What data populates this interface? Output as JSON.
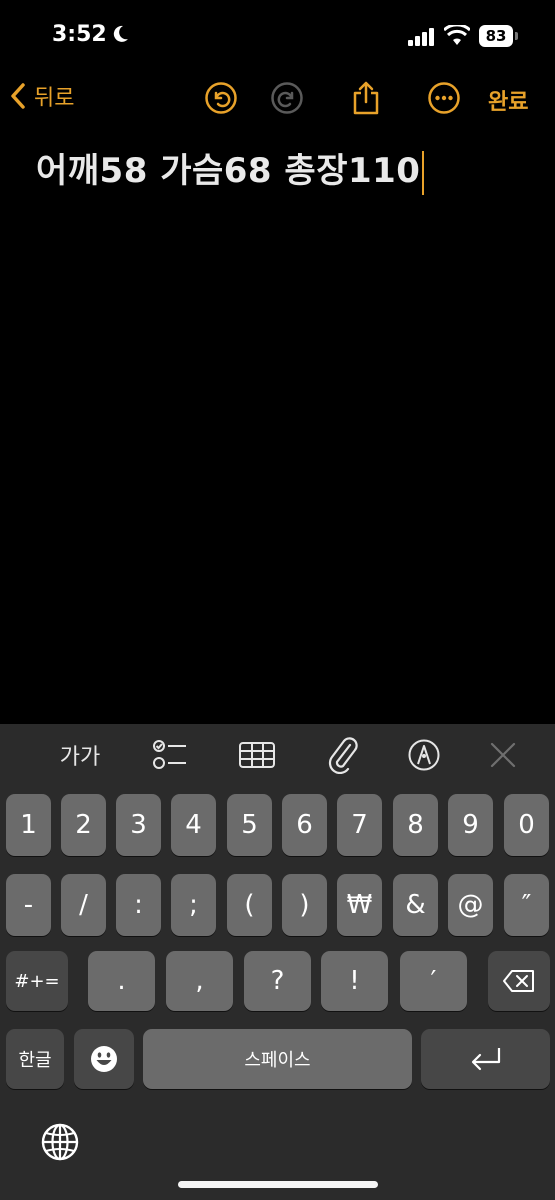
{
  "status_bar": {
    "time": "3:52",
    "battery": "83"
  },
  "nav": {
    "back_label": "뒤로",
    "done_label": "완료"
  },
  "note": {
    "text": "어깨58 가슴68 총장110"
  },
  "toolbar": {
    "text_format_label": "가가"
  },
  "keyboard": {
    "row1": [
      "1",
      "2",
      "3",
      "4",
      "5",
      "6",
      "7",
      "8",
      "9",
      "0"
    ],
    "row2": [
      "-",
      "/",
      ":",
      ";",
      "(",
      ")",
      "₩",
      "&",
      "@",
      "″"
    ],
    "row3": {
      "symbols_label": "#+=",
      "keys": [
        ".",
        ",",
        "?",
        "!",
        "′"
      ]
    },
    "row4": {
      "language_label": "한글",
      "space_label": "스페이스"
    }
  },
  "colors": {
    "accent": "#e8a22a",
    "keyboard_bg": "#2b2b2b",
    "key_bg": "#6b6b6b",
    "key_dark_bg": "#474747"
  }
}
